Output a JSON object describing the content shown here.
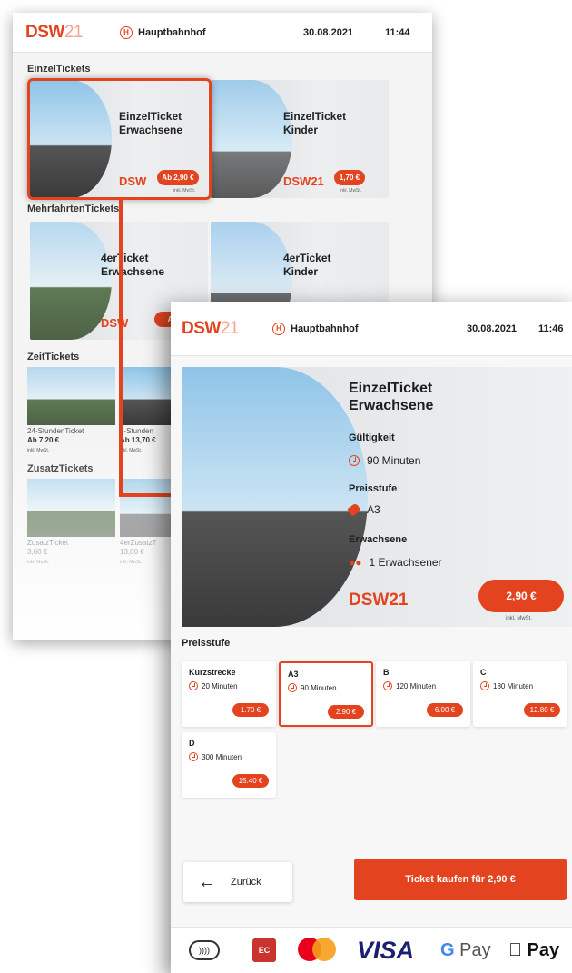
{
  "colors": {
    "accent": "#e3441f",
    "text": "#1e1e1e",
    "background": "#f4f4f4"
  },
  "back_screen": {
    "header": {
      "logo_main": "DSW",
      "logo_suffix": "21",
      "station": "Hauptbahnhof",
      "date": "30.08.2021",
      "time": "11:44",
      "station_icon": "H"
    },
    "sections": {
      "einzel": "EinzelTickets",
      "mehrfahrten": "MehrfahrtenTickets",
      "zeit": "ZeitTickets",
      "zusatz": "ZusatzTickets"
    },
    "einzel_cards": [
      {
        "title1": "EinzelTicket",
        "title2": "Erwachsene",
        "logo": "DSW",
        "price": "Ab 2,90 €",
        "mwst": "inkl. MwSt."
      },
      {
        "title1": "EinzelTicket",
        "title2": "Kinder",
        "logo": "DSW21",
        "price": "1,70 €",
        "mwst": "inkl. MwSt."
      }
    ],
    "mehrfahrten_cards": [
      {
        "title1": "4erTicket",
        "title2": "Erwachsene",
        "logo": "DSW",
        "price": "Ab"
      },
      {
        "title1": "4erTicket",
        "title2": "Kinder"
      }
    ],
    "zeit_items": [
      {
        "name": "24-StundenTicket",
        "price": "Ab 7,20 €",
        "mwst": "inkl. MwSt."
      },
      {
        "name": "9-Stunden",
        "price": "Ab 13,70 €",
        "mwst": "inkl. MwSt."
      }
    ],
    "zusatz_items": [
      {
        "name": "ZusatzTicket",
        "price": "3,60 €",
        "mwst": "inkl. MwSt."
      },
      {
        "name": "4erZusatzT",
        "price": "13,00 €",
        "mwst": "inkl. MwSt."
      }
    ]
  },
  "front_screen": {
    "header": {
      "logo_main": "DSW",
      "logo_suffix": "21",
      "station": "Hauptbahnhof",
      "date": "30.08.2021",
      "time": "11:46",
      "station_icon": "H"
    },
    "ticket": {
      "title1": "EinzelTicket",
      "title2": "Erwachsene",
      "validity_label": "Gültigkeit",
      "validity_value": "90 Minuten",
      "zone_label": "Preisstufe",
      "zone_value": "A3",
      "passenger_label": "Erwachsene",
      "passenger_value": "1 Erwachsener",
      "logo": "DSW21",
      "price": "2,90 €",
      "mwst": "inkl. MwSt."
    },
    "zones_title": "Preisstufe",
    "zones": [
      {
        "name": "Kurzstrecke",
        "time": "20 Minuten",
        "price": "1.70 €"
      },
      {
        "name": "A3",
        "time": "90 Minuten",
        "price": "2.90 €"
      },
      {
        "name": "B",
        "time": "120 Minuten",
        "price": "6.00 €"
      },
      {
        "name": "C",
        "time": "180 Minuten",
        "price": "12.80 €"
      },
      {
        "name": "D",
        "time": "300 Minuten",
        "price": "15.40 €"
      }
    ],
    "selected_zone": "A3",
    "back_button": "Zurück",
    "buy_button": "Ticket kaufen für 2,90 €",
    "payment": {
      "nfc": "))))",
      "ec": "EC",
      "visa": "VISA",
      "gpay_g": "G",
      "gpay_text": " Pay",
      "apple_pay": " Pay",
      "apple_glyph": ""
    }
  }
}
